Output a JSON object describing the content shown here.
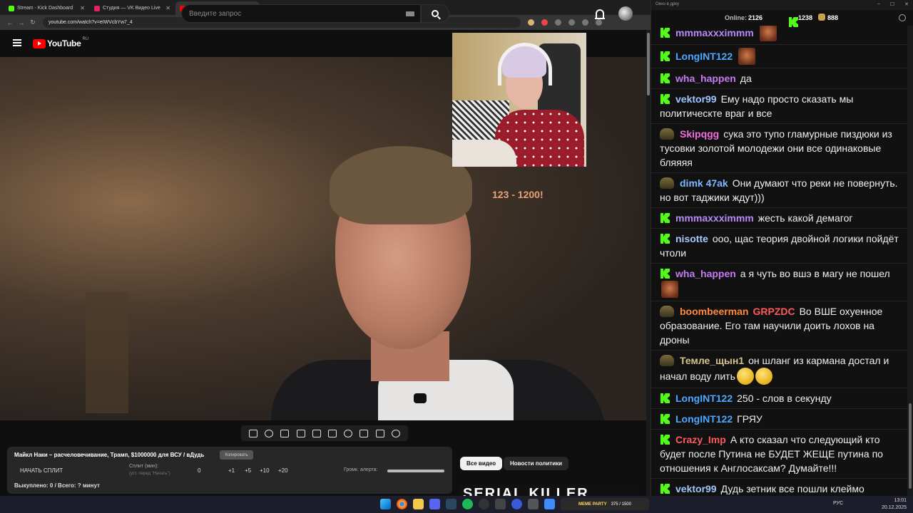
{
  "browser": {
    "tabs": [
      {
        "label": "Stream - Kick Dashboard",
        "favicon_color": "#53fc18"
      },
      {
        "label": "Студия — VK Видео Live",
        "favicon_color": "#e0245e"
      },
      {
        "label": "Майкл Наки – расчелове",
        "favicon_color": "#ff0000",
        "active": true
      }
    ],
    "url": "youtube.com/watch?v=eIWVcbYw7_4"
  },
  "youtube": {
    "logo_text": "YouTube",
    "region": "RU",
    "search_placeholder": "Введите запрос"
  },
  "video": {
    "overlay_text": "123 - 1200!"
  },
  "alert_panel": {
    "title": "Майкл Наки – расчеловечивание, Трамп, $1000000 для ВСУ / вДудь",
    "copy_label": "Копировать",
    "start_split_label": "НАЧАТЬ СПЛИТ",
    "split_label": "Сплит (мин):",
    "split_hint": "(уст. перед \"Начать\")",
    "split_value": "0",
    "increments": [
      "+1",
      "+5",
      "+10",
      "+20"
    ],
    "volume_label": "Громк. алерта:",
    "bought_text": "Выкуплено: 0 / Всего: ? минут"
  },
  "chips": {
    "all_videos": "Все видео",
    "politics": "Новости политики"
  },
  "thumb_text": "SERIAL KILLER",
  "chat": {
    "window_title": "Окно в дрку",
    "online_label": "Online:",
    "online_value": "2126",
    "kick_count": "1238",
    "other_count": "888",
    "messages": [
      {
        "badge": "kick",
        "user": "mmmaxxximmm",
        "color": "#b78af7",
        "text": "",
        "emotes": [
          "face"
        ]
      },
      {
        "badge": "kick",
        "user": "LongINT122",
        "color": "#4aa8ff",
        "text": "",
        "emotes": [
          "face"
        ]
      },
      {
        "badge": "kick",
        "user": "wha_happen",
        "color": "#c47bf0",
        "text": "да",
        "emotes": []
      },
      {
        "badge": "kick",
        "user": "vektor99",
        "color": "#9ec7ff",
        "text": "Ему надо просто сказать мы политическте враг и все",
        "emotes": []
      },
      {
        "badge": "sub",
        "user": "Skipqgg",
        "color": "#f26ddf",
        "text": "сука это тупо гламурные пиздюки из тусовки золотой молодежи они все одинаковые бляяяя",
        "emotes": []
      },
      {
        "badge": "sub",
        "user": "dimk 47ak",
        "color": "#7fb7ff",
        "text": "Они думают что реки не повернуть. но вот таджики ждут)))",
        "emotes": []
      },
      {
        "badge": "kick",
        "user": "mmmaxxximmm",
        "color": "#b78af7",
        "text": "жесть какой демагог",
        "emotes": []
      },
      {
        "badge": "kick",
        "user": "nisotte",
        "color": "#a9c9ff",
        "text": "ооо, щас теория двойной логики пойдёт чтоли",
        "emotes": []
      },
      {
        "badge": "kick",
        "user": "wha_happen",
        "color": "#c47bf0",
        "text": "а я чуть во вшэ в магу не пошел",
        "emotes": [
          "face"
        ]
      },
      {
        "badge": "sub",
        "user": "boombeerman",
        "color": "#ff8a3d",
        "user2": "GRPZDC",
        "color2": "#ff5a5a",
        "text": "Во ВШЕ охуенное образование. Его там научили доить лохов на дроны",
        "emotes": []
      },
      {
        "badge": "sub",
        "user": "Темле_щын1",
        "color": "#d7c28a",
        "text": "он шланг из кармана достал и начал воду лить",
        "emotes": [
          "smile",
          "smile"
        ]
      },
      {
        "badge": "kick",
        "user": "LongINT122",
        "color": "#4aa8ff",
        "text": "250 - слов в секунду",
        "emotes": []
      },
      {
        "badge": "kick",
        "user": "LongINT122",
        "color": "#4aa8ff",
        "text": "ГРЯУ",
        "emotes": []
      },
      {
        "badge": "kick",
        "user": "Crazy_Imp",
        "color": "#ff5a5a",
        "text": "А кто сказал что следующий кто будет после Путина не БУДЕТ ЖЕЩЕ путина по отношения к Англосаксам? Думайте!!!",
        "emotes": []
      },
      {
        "badge": "kick",
        "user": "vektor99",
        "color": "#9ec7ff",
        "text": "Дудь зетник все пошли клеймо",
        "emotes": []
      }
    ]
  },
  "taskbar": {
    "widget_title": "MEME PARTY",
    "widget_progress": "375 / 1500",
    "tray_lang": "РУС",
    "time": "13:01",
    "date": "20.12.2025"
  }
}
